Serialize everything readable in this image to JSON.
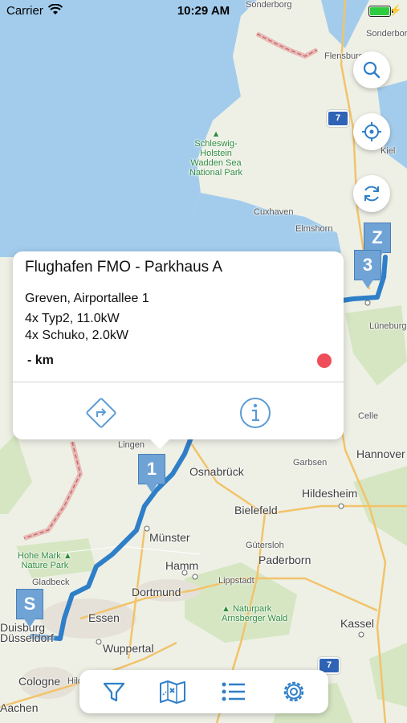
{
  "status_bar": {
    "carrier": "Carrier",
    "time": "10:29 AM"
  },
  "map": {
    "places": [
      "Sonderborg",
      "Flensburg",
      "Kiel",
      "Cuxhaven",
      "Elmshorn",
      "Lüneburg",
      "Celle",
      "Hannover",
      "Garbsen",
      "Hildesheim",
      "Osnabrück",
      "Bielefeld",
      "Münster",
      "Gütersloh",
      "Paderborn",
      "Hamm",
      "Lippstadt",
      "Dortmund",
      "Essen",
      "Wuppertal",
      "Duisburg",
      "Düsseldorf",
      "Cologne",
      "Aachen",
      "Kassel",
      "Gladbeck",
      "Lingen",
      "Hilden"
    ],
    "parks": [
      {
        "name": "Schleswig-Holstein Wadden Sea National Park",
        "lines": [
          "Schleswig-",
          "Holstein",
          "Wadden Sea",
          "National Park"
        ]
      },
      {
        "name": "Hohe Mark Nature Park",
        "lines": [
          "Hohe Mark",
          "Nature Park"
        ]
      },
      {
        "name": "Naturpark Arnsberger Wald",
        "lines": [
          "Naturpark",
          "Arnsberger Wald"
        ]
      }
    ],
    "route_shield": "7",
    "markers": {
      "start": "S",
      "end": "Z",
      "waypoint_1": "1",
      "waypoint_3": "3"
    }
  },
  "popup": {
    "title": "Flughafen FMO - Parkhaus A",
    "address": "Greven, Airportallee 1",
    "connectors": [
      "4x Typ2, 11.0kW",
      "4x Schuko, 2.0kW"
    ],
    "distance": "- km",
    "status_color": "#f04d5a",
    "actions": [
      "directions-icon",
      "info-icon"
    ]
  },
  "buttons": [
    "search-icon",
    "locate-icon",
    "refresh-icon"
  ],
  "tabbar": [
    "filter-icon",
    "map-icon",
    "list-icon",
    "settings-icon"
  ],
  "colors": {
    "accent": "#2f7fc8",
    "route": "#2f7fc8",
    "sea": "#a3ccec",
    "land": "#f1ede4",
    "forest": "#d6e6c3"
  }
}
